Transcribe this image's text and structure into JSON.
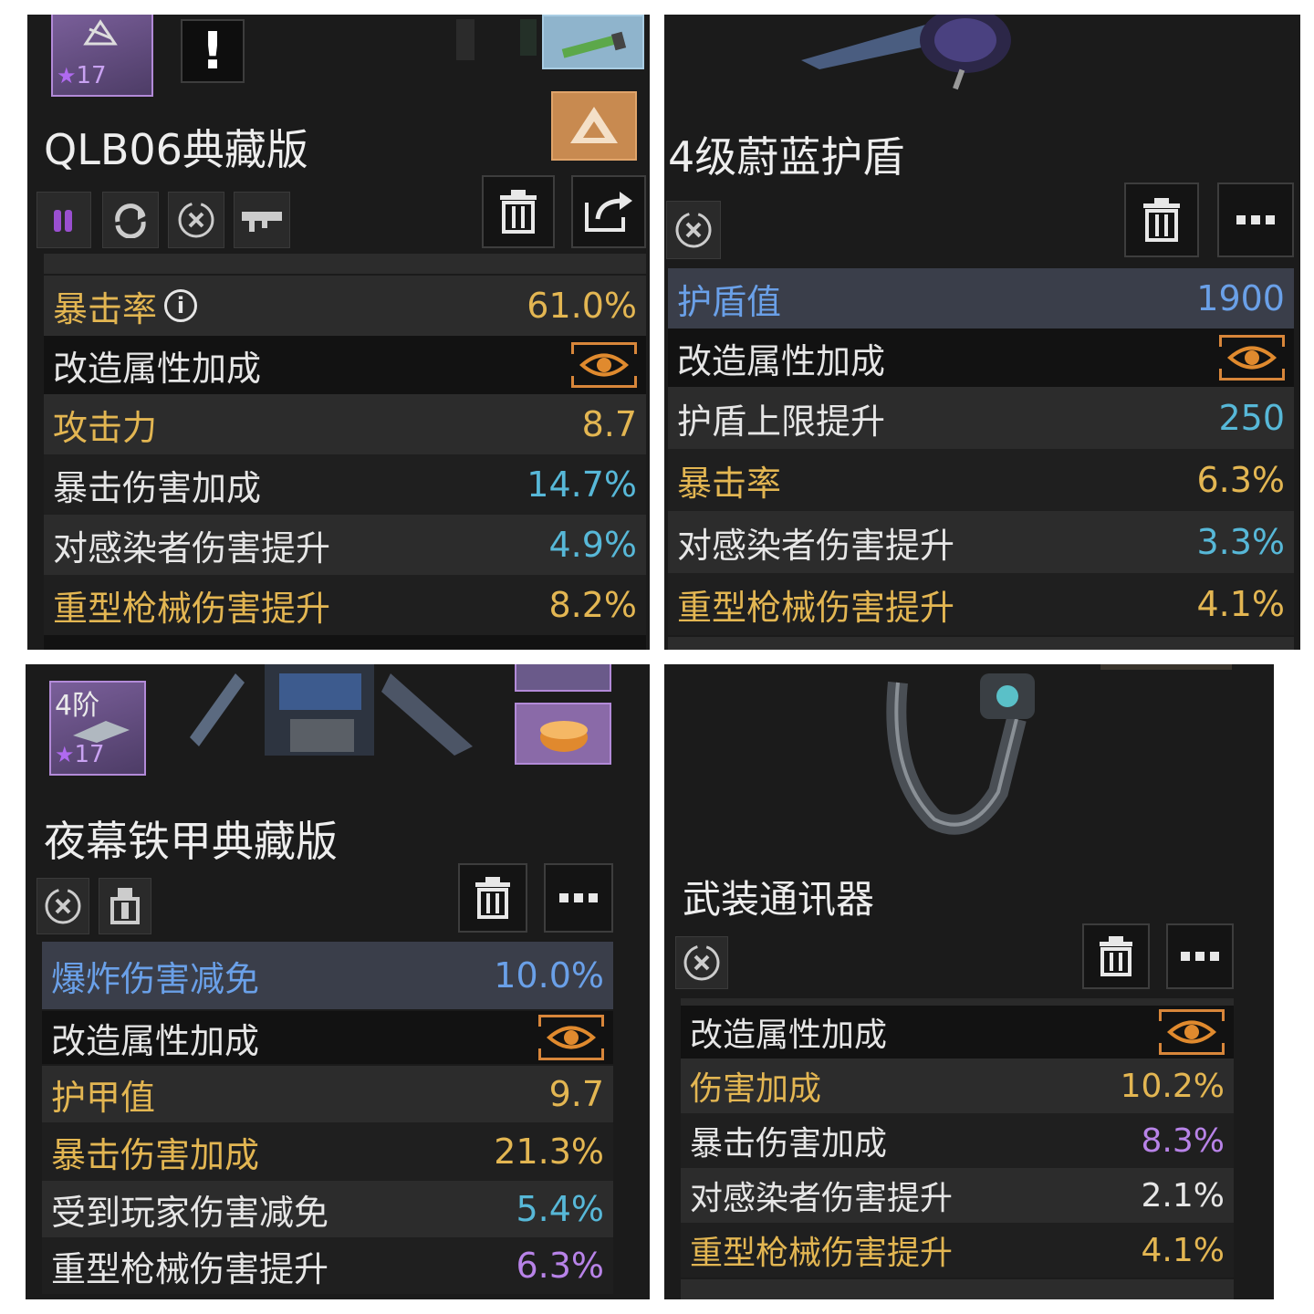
{
  "colors": {
    "gold": "#e3b652",
    "cyan": "#57b8d8",
    "blue": "#6aa0e8",
    "purple": "#b883e8",
    "white": "#e6e6e6",
    "accent_orange": "#d8863a"
  },
  "panels": [
    {
      "title": "QLB06典藏版",
      "thumb": {
        "stars": "17"
      },
      "badge": "!",
      "icons": [
        "ammo-icon",
        "reload-icon",
        "cancel-icon",
        "scope-icon"
      ],
      "actions": [
        "trash-icon",
        "share-icon"
      ],
      "rows": [
        {
          "label": "暴击率",
          "value": "61.0%",
          "style": "gold",
          "info": "i"
        },
        {
          "label": "改造属性加成",
          "header": true
        },
        {
          "label": "攻击力",
          "value": "8.7",
          "style": "gold"
        },
        {
          "label": "暴击伤害加成",
          "value": "14.7%",
          "label_style": "white",
          "value_style": "cyan"
        },
        {
          "label": "对感染者伤害提升",
          "value": "4.9%",
          "label_style": "white",
          "value_style": "cyan"
        },
        {
          "label": "重型枪械伤害提升",
          "value": "8.2%",
          "style": "gold"
        }
      ]
    },
    {
      "title": "4级蔚蓝护盾",
      "icons": [
        "cancel-icon"
      ],
      "actions": [
        "trash-icon",
        "more-icon"
      ],
      "rows": [
        {
          "label": "护盾值",
          "value": "1900",
          "style": "blue"
        },
        {
          "label": "改造属性加成",
          "header": true
        },
        {
          "label": "护盾上限提升",
          "value": "250",
          "label_style": "white",
          "value_style": "cyan"
        },
        {
          "label": "暴击率",
          "value": "6.3%",
          "style": "gold"
        },
        {
          "label": "对感染者伤害提升",
          "value": "3.3%",
          "label_style": "white",
          "value_style": "cyan"
        },
        {
          "label": "重型枪械伤害提升",
          "value": "4.1%",
          "style": "gold"
        }
      ]
    },
    {
      "title": "夜幕铁甲典藏版",
      "thumb": {
        "tier": "4阶",
        "stars": "17"
      },
      "icons": [
        "cancel-icon",
        "armor-icon"
      ],
      "actions": [
        "trash-icon",
        "more-icon"
      ],
      "rows": [
        {
          "label": "爆炸伤害减免",
          "value": "10.0%",
          "style": "blue"
        },
        {
          "label": "改造属性加成",
          "header": true
        },
        {
          "label": "护甲值",
          "value": "9.7",
          "style": "gold"
        },
        {
          "label": "暴击伤害加成",
          "value": "21.3%",
          "style": "gold"
        },
        {
          "label": "受到玩家伤害减免",
          "value": "5.4%",
          "label_style": "white",
          "value_style": "cyan"
        },
        {
          "label": "重型枪械伤害提升",
          "value": "6.3%",
          "label_style": "white",
          "value_style": "purple"
        }
      ]
    },
    {
      "title": "武装通讯器",
      "icons": [
        "cancel-icon"
      ],
      "actions": [
        "trash-icon",
        "more-icon"
      ],
      "rows": [
        {
          "label": "改造属性加成",
          "header": true
        },
        {
          "label": "伤害加成",
          "value": "10.2%",
          "style": "gold"
        },
        {
          "label": "暴击伤害加成",
          "value": "8.3%",
          "label_style": "white",
          "value_style": "purple"
        },
        {
          "label": "对感染者伤害提升",
          "value": "2.1%",
          "label_style": "white",
          "value_style": "white"
        },
        {
          "label": "重型枪械伤害提升",
          "value": "4.1%",
          "style": "gold"
        }
      ]
    }
  ]
}
